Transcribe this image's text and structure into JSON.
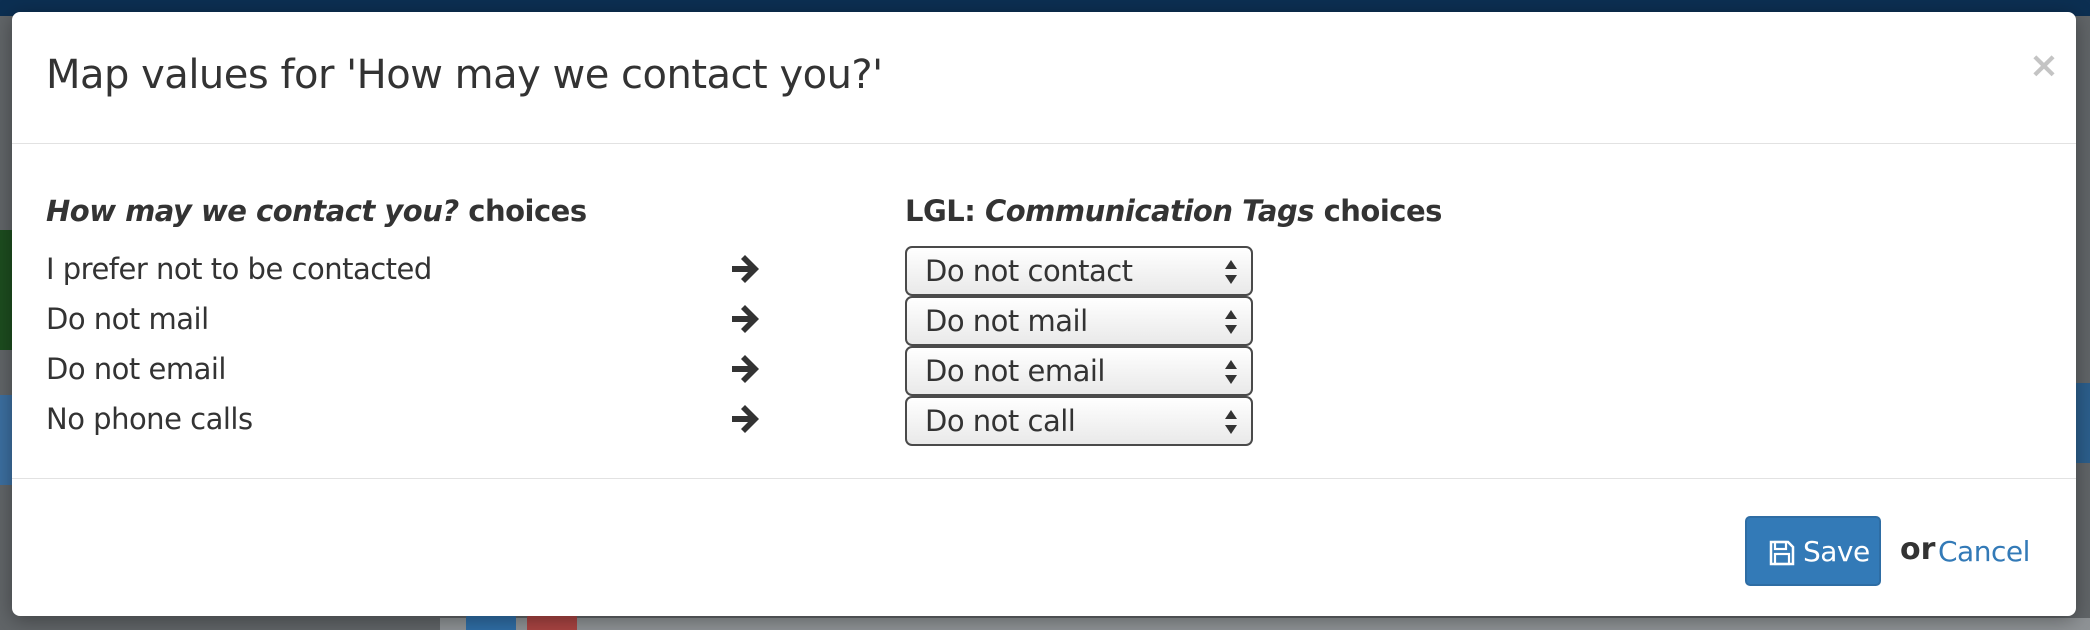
{
  "modal": {
    "title": "Map values for 'How may we contact you?'",
    "close_symbol": "×",
    "left_column": {
      "field_name": "How may we contact you?",
      "suffix": " choices"
    },
    "right_column": {
      "prefix": "LGL: ",
      "field_name": "Communication Tags",
      "suffix": " choices"
    },
    "rows": [
      {
        "source": "I prefer not to be contacted",
        "target": "Do not contact"
      },
      {
        "source": "Do not mail",
        "target": "Do not mail"
      },
      {
        "source": "Do not email",
        "target": "Do not email"
      },
      {
        "source": "No phone calls",
        "target": "Do not call"
      }
    ],
    "footer": {
      "save_label": "Save",
      "or_text": "or",
      "cancel_label": "Cancel"
    }
  },
  "icons": {
    "arrow": "arrow-right-icon",
    "save": "floppy-disk-icon",
    "select": "select-caret-icon",
    "close": "close-icon"
  },
  "colors": {
    "primary": "#337ab7",
    "text": "#333333",
    "close": "#c4c4c4"
  }
}
